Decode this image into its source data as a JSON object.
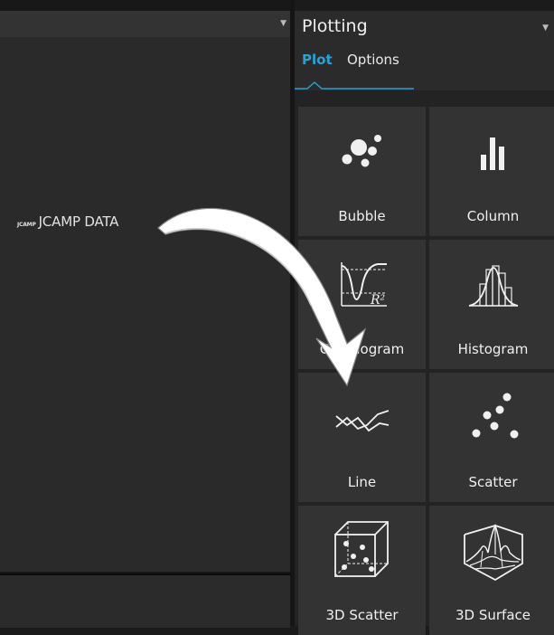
{
  "left_panel": {
    "data_item": {
      "icon": "JCAMP",
      "label": "JCAMP DATA"
    }
  },
  "plotting_panel": {
    "title": "Plotting",
    "tabs": [
      "Plot",
      "Options"
    ],
    "tiles": [
      {
        "label": "Bubble",
        "icon": "bubble-icon"
      },
      {
        "label": "Column",
        "icon": "column-icon"
      },
      {
        "label": "Correlogram",
        "icon": "correlogram-icon"
      },
      {
        "label": "Histogram",
        "icon": "histogram-icon"
      },
      {
        "label": "Line",
        "icon": "line-icon"
      },
      {
        "label": "Scatter",
        "icon": "scatter-icon"
      },
      {
        "label": "3D Scatter",
        "icon": "scatter-3d-icon"
      },
      {
        "label": "3D Surface",
        "icon": "surface-3d-icon"
      }
    ]
  },
  "colors": {
    "accent": "#1fa6db",
    "tile": "#333333",
    "text": "#f0f0f0"
  }
}
